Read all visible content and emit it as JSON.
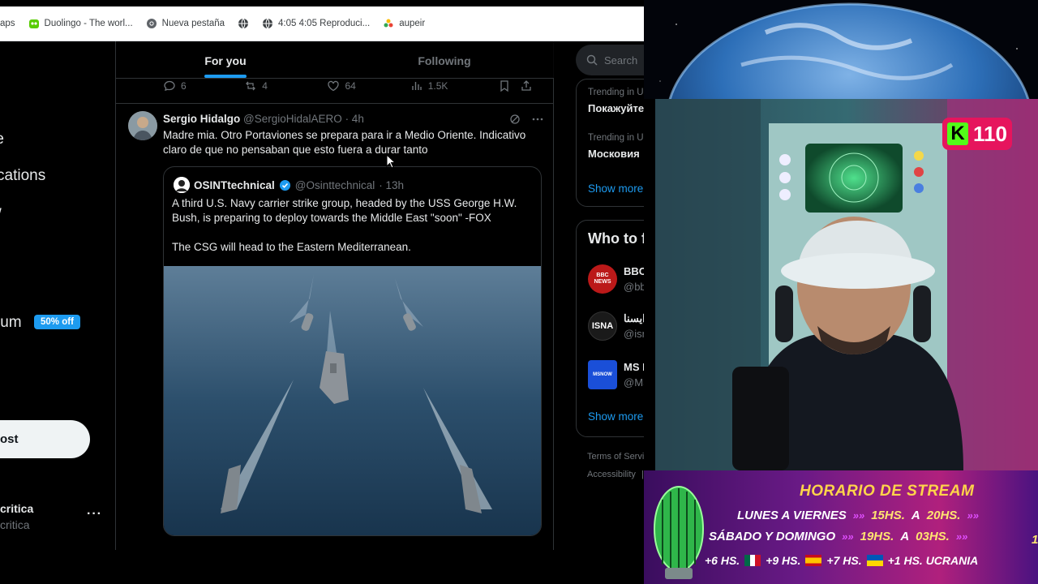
{
  "bookmarks": [
    {
      "label": "aps",
      "icon": "none"
    },
    {
      "label": "Duolingo - The worl...",
      "icon": "duolingo-icon"
    },
    {
      "label": "Nueva pestaña",
      "icon": "chrome-icon"
    },
    {
      "label": "",
      "icon": "globe-icon"
    },
    {
      "label": "4:05 4:05 Reproduci...",
      "icon": "globe-icon"
    },
    {
      "label": "aupeir",
      "icon": "pinwheel-icon"
    }
  ],
  "nav": {
    "items": [
      "e",
      "re",
      "cations",
      "w",
      "ium",
      "e"
    ],
    "premium_badge": "50% off",
    "post_button": "ost",
    "account_name": "critica",
    "account_handle": "critica",
    "more": "···"
  },
  "tabs": [
    {
      "label": "For you",
      "active": true
    },
    {
      "label": "Following",
      "active": false
    }
  ],
  "prev_post_actions": {
    "replies": "6",
    "reposts": "4",
    "likes": "64",
    "views": "1.5K"
  },
  "post": {
    "author": "Sergio Hidalgo",
    "handle": "@SergioHidalAERO",
    "time": "· 4h",
    "text": "Madre mia. Otro Portaviones se prepara para ir a Medio Oriente. Indicativo claro de que no pensaban que esto fuera a durar tanto",
    "quote": {
      "author": "OSINTtechnical",
      "handle": "@Osinttechnical",
      "time": "· 13h",
      "text1": "A third U.S. Navy carrier strike group, headed by the USS George H.W. Bush, is preparing to deploy towards the Middle East \"soon\" -FOX",
      "text2": "The CSG will head to the Eastern Mediterranean."
    }
  },
  "sidebar": {
    "search_placeholder": "Search",
    "trends": [
      {
        "context": "Trending in U",
        "title": "Покажуйте"
      },
      {
        "context": "Trending in Ukra",
        "title": "Московия"
      }
    ],
    "show_more": "Show more",
    "who_title": "Who to fo",
    "who": [
      {
        "name": "BBC N",
        "handle": "@bbcp",
        "avatar_text": "BBC NEWS",
        "color": "#bb1919"
      },
      {
        "name": "ری ایسنا",
        "handle": "@isna_",
        "avatar_text": "ISNA",
        "color": "#1a1a1a"
      },
      {
        "name": "MS NO",
        "handle": "@MSN",
        "avatar_text": "MSNOW",
        "color": "#1a4fd8"
      }
    ],
    "show_more_2": "Show more",
    "footer": [
      "Terms of Service",
      "|",
      "Accessibility",
      "|"
    ]
  },
  "stream": {
    "kick_count": "110",
    "banner_title": "HORARIO DE STREAM",
    "rows": [
      {
        "days": "LUNES A VIERNES",
        "from": "15HS.",
        "sep": "A",
        "to": "20HS."
      },
      {
        "days": "SÁBADO Y DOMINGO",
        "from": "19HS.",
        "sep": "A",
        "to": "03HS."
      }
    ],
    "tz": [
      "+6 HS.",
      "+9 HS.",
      "+7 HS.",
      "+1 HS. UCRANIA"
    ],
    "edge_digit": "1"
  }
}
